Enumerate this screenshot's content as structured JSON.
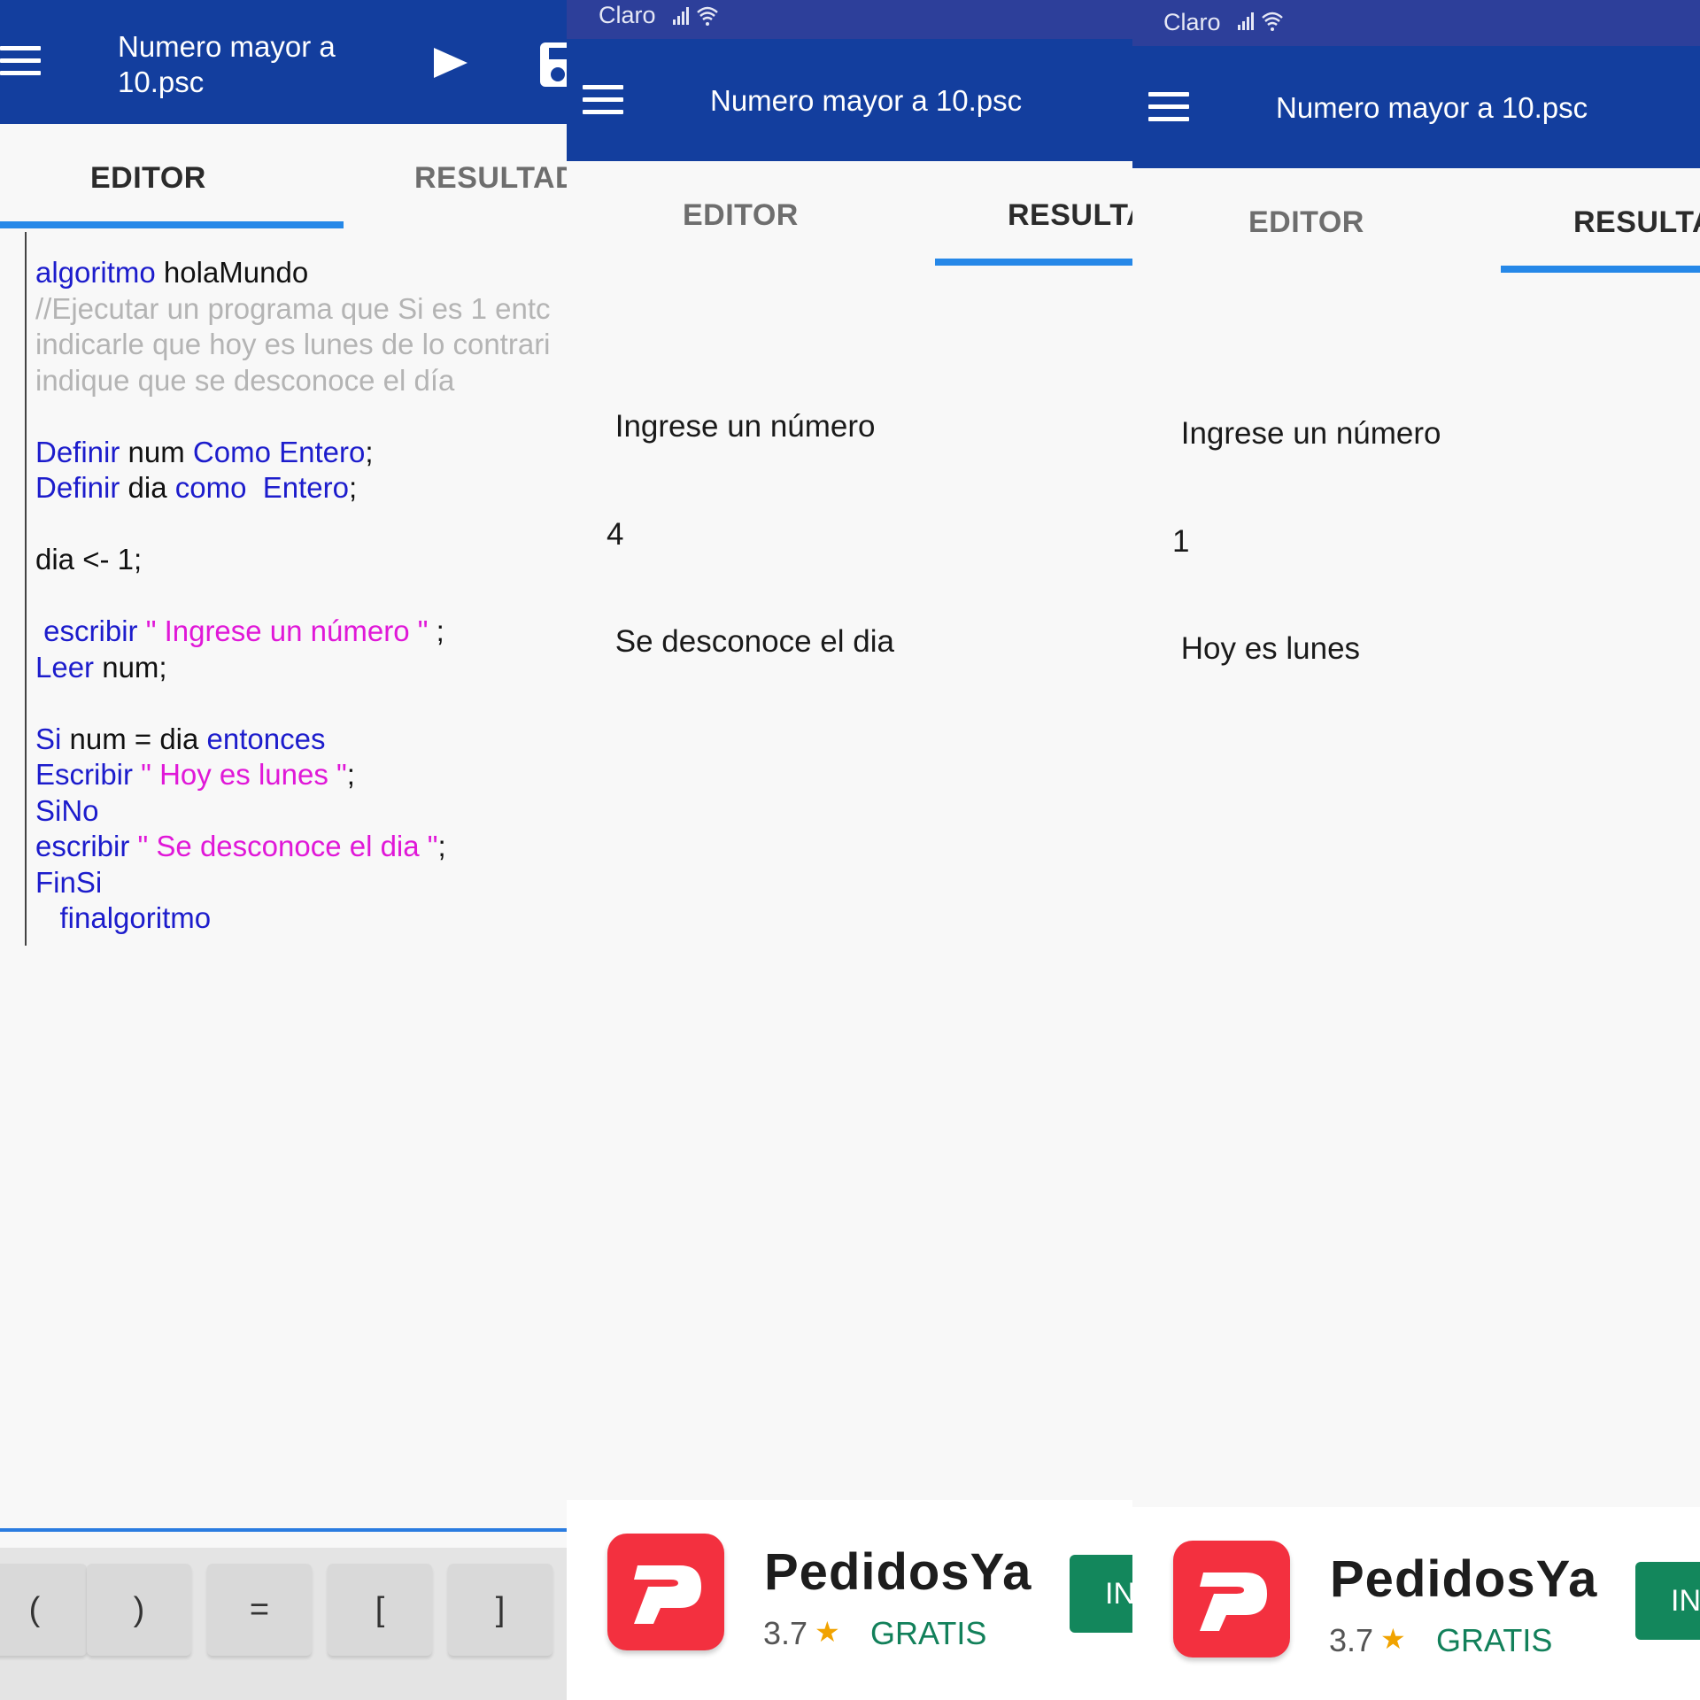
{
  "panel_editor": {
    "title": "Numero mayor a\n10.psc",
    "run_icon": "play-icon",
    "save_icon": "save-icon",
    "menu_icon": "menu-icon",
    "tabs": [
      {
        "label": "EDITOR"
      },
      {
        "label": "RESULTAD"
      }
    ],
    "code_lines": [
      [
        {
          "t": "algoritmo",
          "c": "kw"
        },
        {
          "t": " holaMundo",
          "c": "n"
        }
      ],
      [
        {
          "t": "//Ejecutar un programa que Si es 1 entc",
          "c": "cm"
        }
      ],
      [
        {
          "t": "indicarle que hoy es lunes de lo contrari",
          "c": "cm"
        }
      ],
      [
        {
          "t": "indique que se desconoce el día",
          "c": "cm"
        }
      ],
      [],
      [
        {
          "t": "Definir",
          "c": "kw"
        },
        {
          "t": " num ",
          "c": "n"
        },
        {
          "t": "Como Entero",
          "c": "kw"
        },
        {
          "t": ";",
          "c": "n"
        }
      ],
      [
        {
          "t": "Definir",
          "c": "kw"
        },
        {
          "t": " dia ",
          "c": "n"
        },
        {
          "t": "como  Entero",
          "c": "kw"
        },
        {
          "t": ";",
          "c": "n"
        }
      ],
      [],
      [
        {
          "t": "dia <- 1;",
          "c": "n"
        }
      ],
      [],
      [
        {
          "t": " escribir ",
          "c": "kw"
        },
        {
          "t": "\" Ingrese un número \"",
          "c": "str"
        },
        {
          "t": " ;",
          "c": "n"
        }
      ],
      [
        {
          "t": "Leer",
          "c": "kw"
        },
        {
          "t": " num;",
          "c": "n"
        }
      ],
      [],
      [
        {
          "t": "Si",
          "c": "kw"
        },
        {
          "t": " num = dia ",
          "c": "n"
        },
        {
          "t": "entonces",
          "c": "kw"
        }
      ],
      [
        {
          "t": "Escribir",
          "c": "kw"
        },
        {
          "t": " \" Hoy es lunes \"",
          "c": "str"
        },
        {
          "t": ";",
          "c": "n"
        }
      ],
      [
        {
          "t": "SiNo",
          "c": "kw"
        }
      ],
      [
        {
          "t": "escribir",
          "c": "kw"
        },
        {
          "t": " \" Se desconoce el dia \"",
          "c": "str"
        },
        {
          "t": ";",
          "c": "n"
        }
      ],
      [
        {
          "t": "FinSi",
          "c": "kw"
        }
      ],
      [
        {
          "t": "   finalgoritmo",
          "c": "kw"
        }
      ]
    ],
    "keys": [
      "(",
      ")",
      "=",
      "[",
      "]"
    ]
  },
  "panel_result_1": {
    "carrier": "Claro",
    "title": "Numero mayor a 10.psc",
    "tabs": [
      {
        "label": "EDITOR"
      },
      {
        "label": "RESULTA"
      }
    ],
    "output": [
      " Ingrese un número",
      "4",
      " Se desconoce el dia"
    ]
  },
  "panel_result_2": {
    "carrier": "Claro",
    "title": "Numero mayor a 10.psc",
    "tabs": [
      {
        "label": "EDITOR"
      },
      {
        "label": "RESULTA"
      }
    ],
    "output": [
      " Ingrese un número",
      "1",
      " Hoy es lunes"
    ]
  },
  "ad": {
    "app_name": "PedidosYa",
    "rating": "3.7",
    "price": "GRATIS",
    "install_label": "IN",
    "brand_color": "#f3303f",
    "star_color": "#f1a300",
    "install_color": "#13875c"
  },
  "colors": {
    "appbar": "#133e9e",
    "statusbar": "#2d3f9a",
    "tab_indicator": "#2688e8",
    "keyword": "#1c1ccc",
    "string": "#e018d8",
    "comment": "#b4b4b4"
  }
}
